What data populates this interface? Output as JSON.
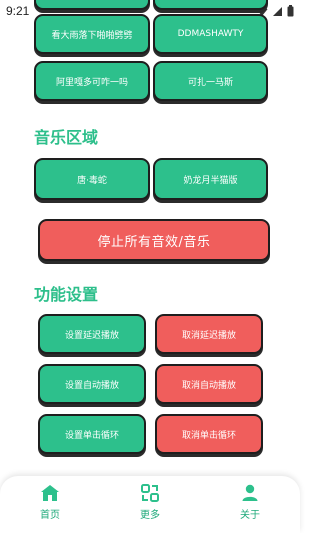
{
  "status_bar": {
    "time": "9:21",
    "icons": [
      "wifi-icon",
      "signal-icon",
      "battery-icon"
    ]
  },
  "sound_buttons": {
    "row1": [
      "看大雨落下啪啪劈劈",
      "DDMASHAWTY"
    ],
    "row2": [
      "阿里嘎多可咋一吗",
      "可扎一马斯"
    ]
  },
  "music_section": {
    "title": "音乐区域",
    "items": [
      "唐·毒蛇",
      "奶龙月半猫版"
    ]
  },
  "stop_all": "停止所有音效/音乐",
  "settings_section": {
    "title": "功能设置",
    "set_delay": "设置延迟播放",
    "cancel_delay": "取消延迟播放",
    "set_auto": "设置自动播放",
    "cancel_auto": "取消自动播放",
    "set_loop": "设置单击循环",
    "cancel_loop": "取消单击循环"
  },
  "bottom_nav": {
    "home": "首页",
    "more": "更多",
    "about": "关于"
  },
  "colors": {
    "green": "#2dc08c",
    "red": "#f05e5c",
    "accent_text": "#1ea97a"
  }
}
